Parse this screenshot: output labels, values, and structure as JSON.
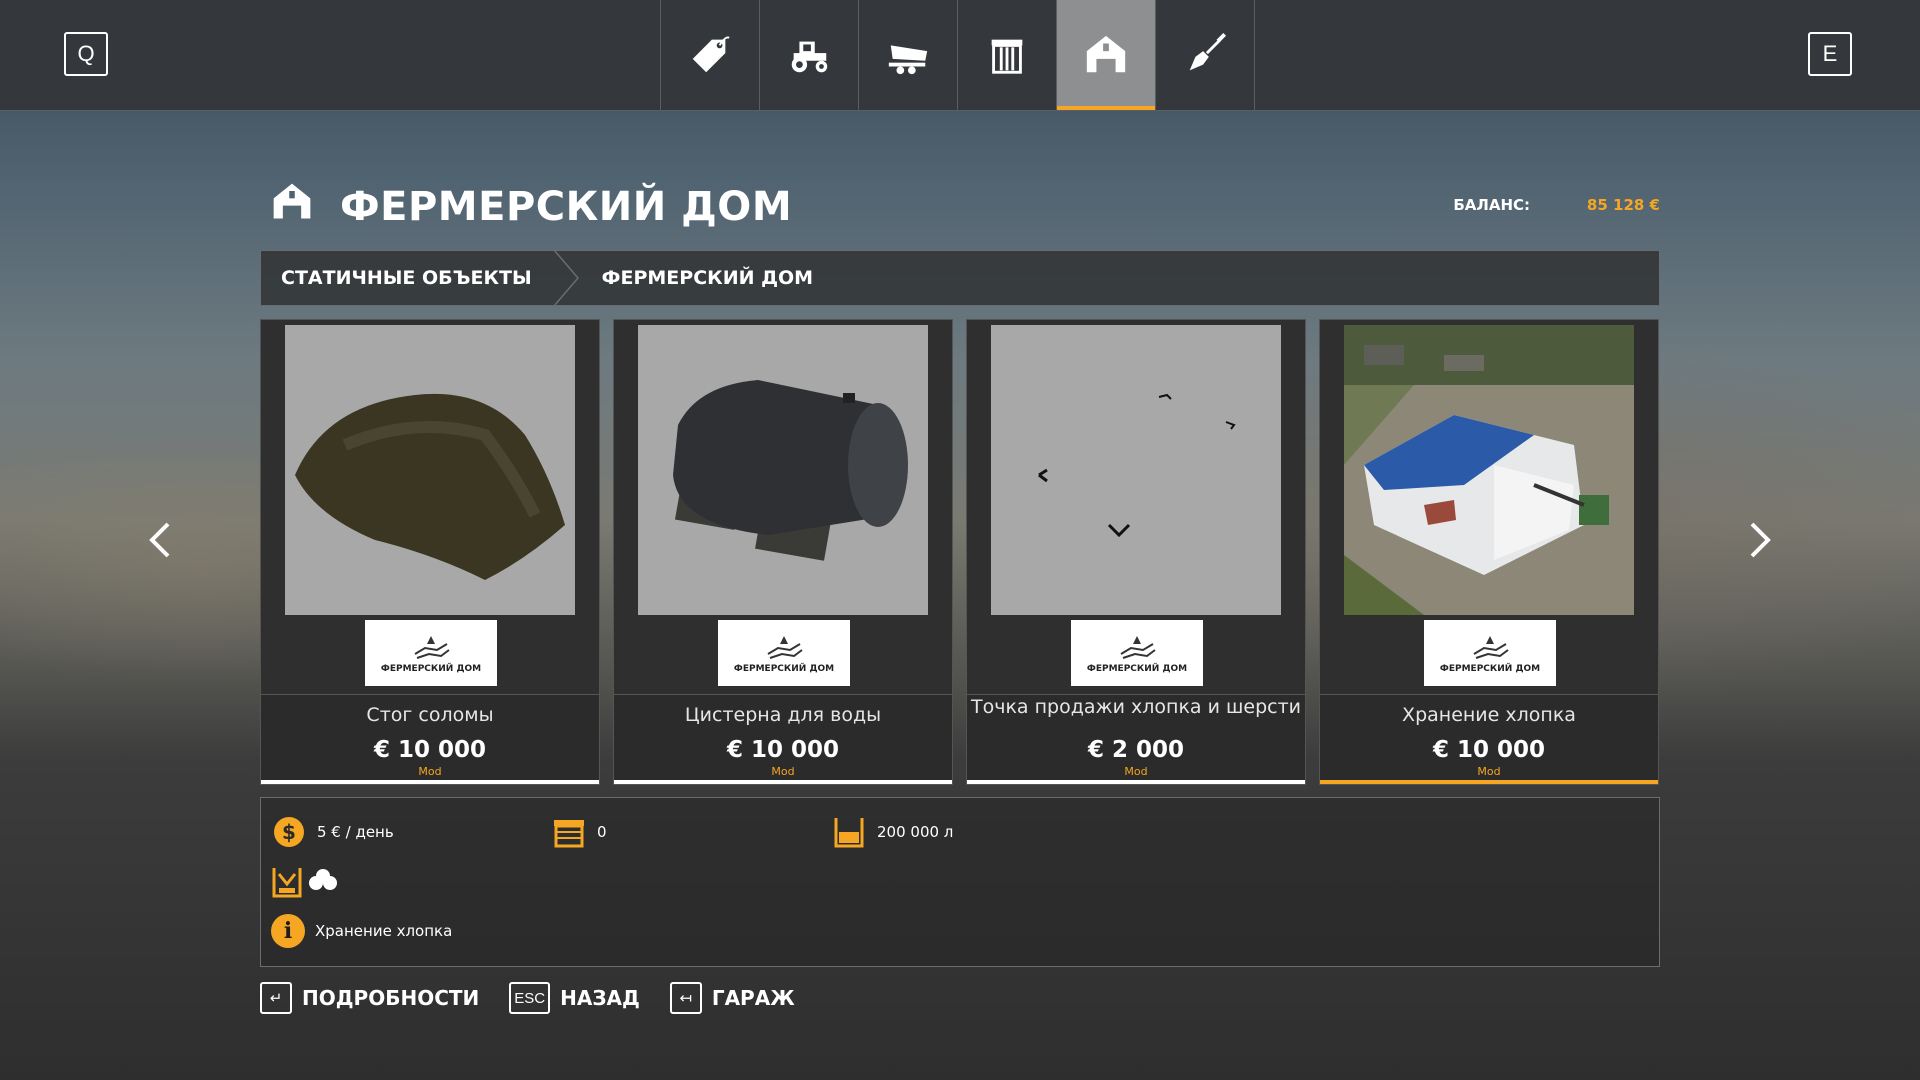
{
  "topbar": {
    "left_key": "Q",
    "right_key": "E",
    "tabs": [
      {
        "icon": "price-tag-icon"
      },
      {
        "icon": "tractor-icon"
      },
      {
        "icon": "trailer-icon"
      },
      {
        "icon": "silo-icon"
      },
      {
        "icon": "farmhouse-icon",
        "active": true
      },
      {
        "icon": "shovel-icon"
      }
    ]
  },
  "header": {
    "icon": "farmhouse-icon",
    "title": "ФЕРМЕРСКИЙ ДОМ",
    "balance_label": "БАЛАНС:",
    "balance_value": "85 128 €"
  },
  "breadcrumb": {
    "items": [
      "СТАТИЧНЫЕ ОБЪЕКТЫ",
      "ФЕРМЕРСКИЙ ДОМ"
    ]
  },
  "cards": [
    {
      "name": "Стог соломы",
      "price": "€ 10 000",
      "tag": "Mod",
      "brand": "ФЕРМЕРСКИЙ ДОМ"
    },
    {
      "name": "Цистерна для воды",
      "price": "€ 10 000",
      "tag": "Mod",
      "brand": "ФЕРМЕРСКИЙ ДОМ"
    },
    {
      "name": "Точка продажи хлопка и шерсти",
      "price": "€ 2 000",
      "tag": "Mod",
      "brand": "ФЕРМЕРСКИЙ ДОМ"
    },
    {
      "name": "Хранение хлопка",
      "price": "€ 10 000",
      "tag": "Mod",
      "brand": "ФЕРМЕРСКИЙ ДОМ",
      "selected": true
    }
  ],
  "info": {
    "upkeep": "5 € / день",
    "slots": "0",
    "capacity": "200 000 л",
    "description": "Хранение хлопка",
    "icons": [
      "storage-icon",
      "cotton-icon"
    ]
  },
  "footer": [
    {
      "key": "↵",
      "label": "ПОДРОБНОСТИ"
    },
    {
      "key": "ESC",
      "label": "НАЗАД"
    },
    {
      "key": "↤",
      "label": "ГАРАЖ"
    }
  ],
  "colors": {
    "accent": "#f5a623",
    "bar": "#34383d"
  }
}
